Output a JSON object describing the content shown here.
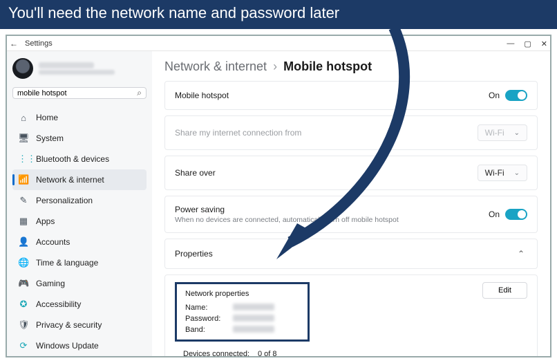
{
  "annotation": {
    "banner": "You'll need the network name and password later"
  },
  "titlebar": {
    "app": "Settings"
  },
  "search": {
    "value": "mobile hotspot"
  },
  "nav": [
    {
      "label": "Home"
    },
    {
      "label": "System"
    },
    {
      "label": "Bluetooth & devices"
    },
    {
      "label": "Network & internet"
    },
    {
      "label": "Personalization"
    },
    {
      "label": "Apps"
    },
    {
      "label": "Accounts"
    },
    {
      "label": "Time & language"
    },
    {
      "label": "Gaming"
    },
    {
      "label": "Accessibility"
    },
    {
      "label": "Privacy & security"
    },
    {
      "label": "Windows Update"
    }
  ],
  "breadcrumb": {
    "parent": "Network & internet",
    "current": "Mobile hotspot"
  },
  "cards": {
    "mobileHotspot": {
      "title": "Mobile hotspot",
      "state": "On"
    },
    "shareFrom": {
      "title": "Share my internet connection from",
      "value": "Wi-Fi"
    },
    "shareOver": {
      "title": "Share over",
      "value": "Wi-Fi"
    },
    "powerSaving": {
      "title": "Power saving",
      "sub": "When no devices are connected, automatically turn off mobile hotspot",
      "state": "On"
    },
    "properties": {
      "title": "Properties",
      "netprops": {
        "heading": "Network properties",
        "name_label": "Name:",
        "password_label": "Password:",
        "band_label": "Band:"
      },
      "edit": "Edit",
      "devices_label": "Devices connected:",
      "devices_value": "0 of 8"
    }
  }
}
